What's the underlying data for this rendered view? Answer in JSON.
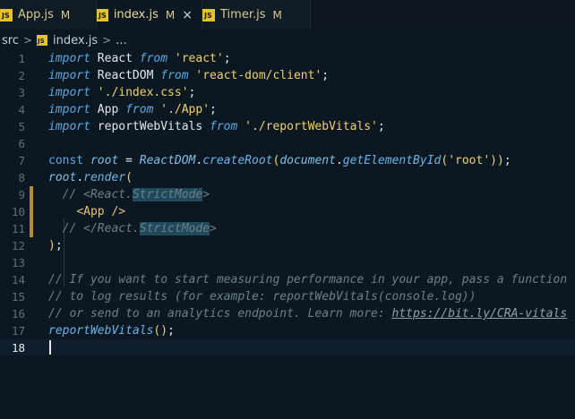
{
  "tabs": [
    {
      "name": "App.js",
      "status": "M",
      "icon": "JS",
      "active": false
    },
    {
      "name": "index.js",
      "status": "M",
      "icon": "JS",
      "active": true,
      "close": "×"
    },
    {
      "name": "Timer.js",
      "status": "M",
      "icon": "JS",
      "active": false
    }
  ],
  "breadcrumb": {
    "folder": "src",
    "file": "index.js",
    "sep": ">",
    "more": "..."
  },
  "lines": [
    {
      "n": "1"
    },
    {
      "n": "2"
    },
    {
      "n": "3"
    },
    {
      "n": "4"
    },
    {
      "n": "5"
    },
    {
      "n": "6"
    },
    {
      "n": "7"
    },
    {
      "n": "8"
    },
    {
      "n": "9"
    },
    {
      "n": "10"
    },
    {
      "n": "11"
    },
    {
      "n": "12"
    },
    {
      "n": "13"
    },
    {
      "n": "14"
    },
    {
      "n": "15"
    },
    {
      "n": "16"
    },
    {
      "n": "17"
    },
    {
      "n": "18"
    }
  ],
  "code": {
    "l1": {
      "kw": "import",
      "name": " React ",
      "from": "from",
      "str": " 'react'",
      "end": ";"
    },
    "l2": {
      "kw": "import",
      "name": " ReactDOM ",
      "from": "from",
      "str": " 'react-dom/client'",
      "end": ";"
    },
    "l3": {
      "kw": "import",
      "str": " './index.css'",
      "end": ";"
    },
    "l4": {
      "kw": "import",
      "name": " App ",
      "from": "from",
      "str": " './App'",
      "end": ";"
    },
    "l5": {
      "kw": "import",
      "name": " reportWebVitals ",
      "from": "from",
      "str": " './reportWebVitals'",
      "end": ";"
    },
    "l7": {
      "const": "const",
      "root": "root",
      "eq": " = ",
      "obj": "ReactDOM",
      "dot": ".",
      "fn": "createRoot",
      "p1": "(",
      "doc": "document",
      "dot2": ".",
      "fn2": "getElementById",
      "p2": "(",
      "str": "'root'",
      "p3": ")",
      "p4": ")",
      "end": ";"
    },
    "l8": {
      "root": "root",
      "dot": ".",
      "fn": "render",
      "p": "("
    },
    "l9": {
      "c1": "// <React.",
      "hl": "StrictMode",
      "c2": ">"
    },
    "l10": {
      "tag": "<App />"
    },
    "l11": {
      "c1": "// </React.",
      "hl": "StrictMode",
      "c2": ">"
    },
    "l12": {
      "p": ")",
      "end": ";"
    },
    "l14": "// If you want to start measuring performance in your app, pass a function",
    "l15": "// to log results (for example: reportWebVitals(console.log))",
    "l16": {
      "text": "// or send to an analytics endpoint. Learn more: ",
      "link": "https://bit.ly/CRA-vitals"
    },
    "l17": {
      "fn": "reportWebVitals",
      "p": "()",
      "end": ";"
    }
  },
  "colors": {
    "background": "#0c1821",
    "keyword": "#5aa9e6",
    "string": "#f2d06b",
    "comment": "#6d7f8c",
    "modified_marker": "#b58d2a",
    "js_badge": "#e5c22e"
  }
}
